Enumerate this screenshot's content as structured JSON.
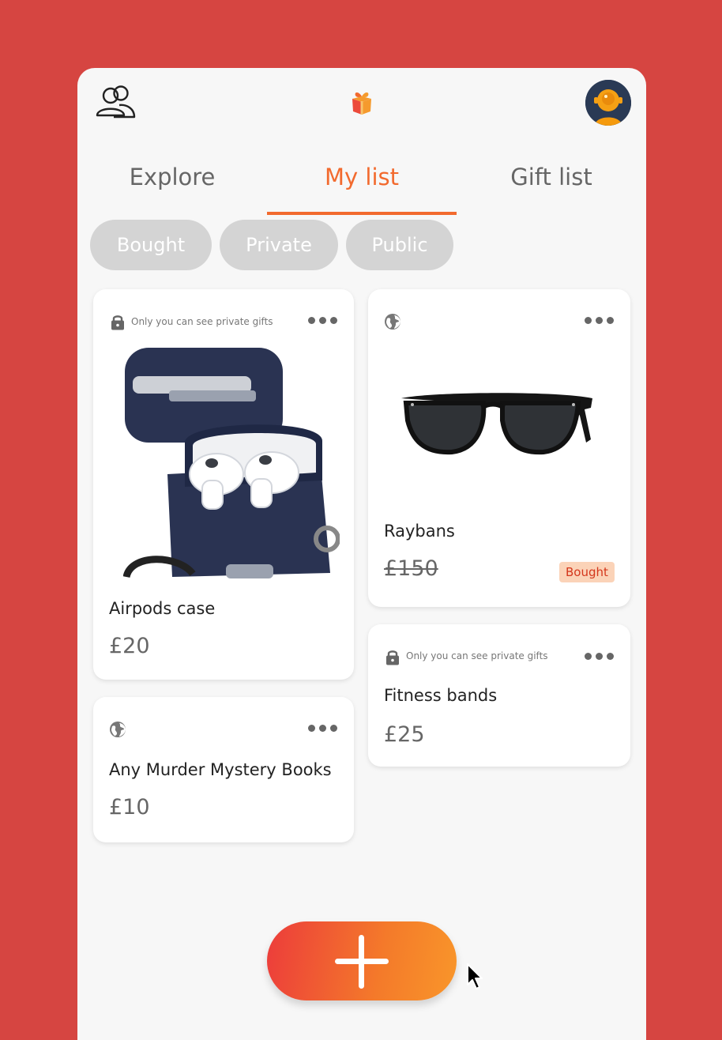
{
  "header": {
    "friends_icon": "people-outline-icon",
    "logo_icon": "gift-box-icon",
    "avatar_icon": "astronaut-avatar"
  },
  "tabs": [
    {
      "label": "Explore",
      "active": false
    },
    {
      "label": "My list",
      "active": true
    },
    {
      "label": "Gift list",
      "active": false
    }
  ],
  "filters": [
    {
      "label": "Bought"
    },
    {
      "label": "Private"
    },
    {
      "label": "Public"
    }
  ],
  "items": [
    {
      "title": "Airpods case",
      "price": "£20",
      "visibility": "private",
      "visibility_icon": "lock-icon",
      "note": "Only you can see private gifts",
      "image": "airpods-case-image"
    },
    {
      "title": "Any Murder Mystery Books",
      "price": "£10",
      "visibility": "public",
      "visibility_icon": "globe-icon"
    },
    {
      "title": "Raybans",
      "price": "£150",
      "visibility": "public",
      "visibility_icon": "globe-icon",
      "image": "sunglasses-image",
      "bought": true,
      "badge": "Bought"
    },
    {
      "title": "Fitness bands",
      "price": "£25",
      "visibility": "private",
      "visibility_icon": "lock-icon",
      "note": "Only you can see private gifts"
    }
  ],
  "colors": {
    "background": "#d64541",
    "accent": "#f26a2e",
    "chip": "#d4d4d4",
    "badge_bg": "#fbd3b8",
    "badge_text": "#d4371c"
  },
  "fab": {
    "icon": "plus-icon"
  }
}
